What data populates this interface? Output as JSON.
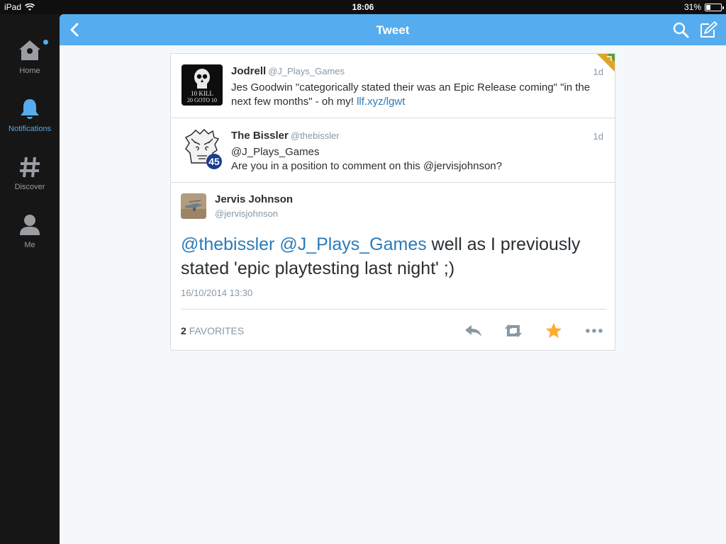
{
  "status_bar": {
    "device": "iPad",
    "time": "18:06",
    "battery_text": "31%",
    "battery_level": 0.31
  },
  "sidebar": {
    "items": [
      {
        "label": "Home",
        "icon": "home-icon",
        "active": false,
        "badge": true
      },
      {
        "label": "Notifications",
        "icon": "bell-icon",
        "active": true
      },
      {
        "label": "Discover",
        "icon": "hash-icon",
        "active": false
      },
      {
        "label": "Me",
        "icon": "person-icon",
        "active": false
      }
    ]
  },
  "header": {
    "title": "Tweet",
    "back_icon": "chevron-left-icon",
    "search_icon": "search-icon",
    "compose_icon": "compose-icon"
  },
  "tweets": [
    {
      "name": "Jodrell",
      "handle": "@J_Plays_Games",
      "age": "1d",
      "text": "Jes Goodwin \"categorically stated their was an Epic Release coming\" \"in the next few months\" - oh my! ",
      "link": "llf.xyz/lgwt",
      "avatar_text": [
        "10 KILL",
        "20 GOTO 10"
      ]
    },
    {
      "name": "The Bissler",
      "handle": "@thebissler",
      "age": "1d",
      "line1": "@J_Plays_Games",
      "line2": "Are you in a position to comment on this @jervisjohnson?",
      "avatar_badge": "45"
    }
  ],
  "detail": {
    "name": "Jervis Johnson",
    "handle": "@jervisjohnson",
    "mention1": "@thebissler",
    "mention2": "@J_Plays_Games",
    "text": " well as I previously stated 'epic playtesting last night' ;)",
    "date": "16/10/2014 13:30",
    "favorites_count": "2",
    "favorites_label": "FAVORITES",
    "actions": [
      "reply-icon",
      "retweet-icon",
      "favorite-star-icon",
      "more-icon"
    ]
  },
  "colors": {
    "accent": "#55acee",
    "star": "#ffac33",
    "link": "#2b7bb9"
  }
}
